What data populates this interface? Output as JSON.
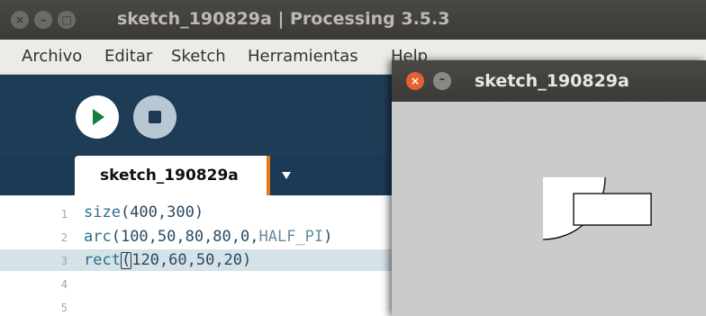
{
  "ide": {
    "window_title": "sketch_190829a | Processing 3.5.3",
    "titlebar_buttons": [
      "close-icon",
      "minimize-icon",
      "maximize-icon"
    ],
    "menu": [
      "Archivo",
      "Editar",
      "Sketch",
      "Herramientas",
      "Help"
    ],
    "tab_label": "sketch_190829a",
    "line_numbers": [
      "1",
      "2",
      "3",
      "4",
      "5"
    ],
    "code": {
      "line1": {
        "fn": "size",
        "args": "(400,300)"
      },
      "line2": {
        "fn": "arc",
        "args": "(100,50,80,80,0,",
        "const": "HALF_PI",
        "close": ")"
      },
      "line3": {
        "fn": "rect",
        "open": "(",
        "args": "120,60,50,20)"
      }
    },
    "colors": {
      "accent_tab": "#e37b16",
      "run": "#1a7d3a",
      "toolbar": "#1f3c56"
    }
  },
  "sketch_window": {
    "title": "sketch_190829a",
    "buttons": [
      "close-icon",
      "minimize-icon"
    ]
  }
}
